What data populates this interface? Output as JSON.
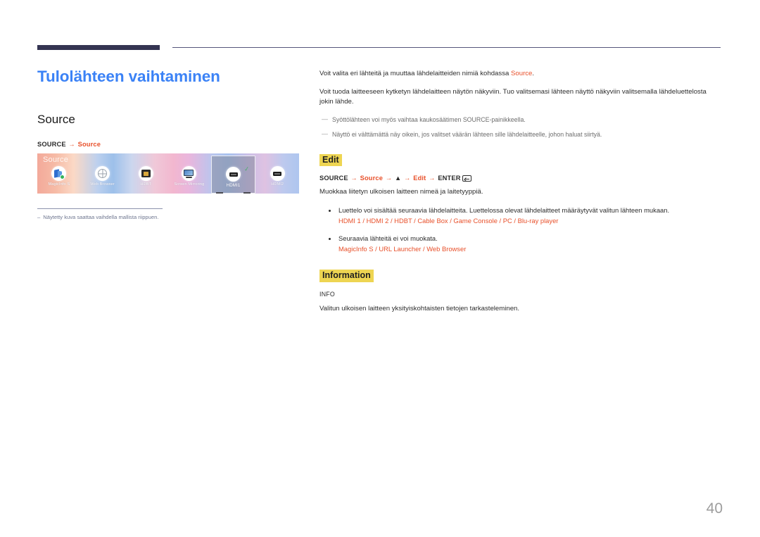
{
  "document": {
    "title": "Tulolähteen vaihtaminen",
    "page_number": "40",
    "accent_color": "#e8502a",
    "title_color": "#3b82f6",
    "highlight_color": "#eed552",
    "rule_color": "#343452"
  },
  "left": {
    "section_heading": "Source",
    "path": {
      "root": "SOURCE",
      "arrow": "→",
      "target": "Source"
    },
    "screenshot": {
      "overlay_label": "Source",
      "items": [
        {
          "label": "MagicInfo S",
          "icon": "magicinfo-icon",
          "selected": false
        },
        {
          "label": "Web Browser",
          "icon": "globe-icon",
          "selected": false
        },
        {
          "label": "HDBT",
          "icon": "hdbt-connector-icon",
          "selected": false
        },
        {
          "label": "Screen Mirroring",
          "icon": "screen-mirroring-icon",
          "selected": false
        },
        {
          "label": "HDMI1",
          "icon": "hdmi-port-icon",
          "selected": true
        },
        {
          "label": "HDMI2",
          "icon": "hdmi-port-icon",
          "selected": false
        }
      ],
      "caret_glyph": "⌃",
      "check_glyph": "✓"
    },
    "caption": {
      "dash": "‒",
      "text": "Näytetty kuva saattaa vaihdella mallista riippuen."
    }
  },
  "right": {
    "intro_paragraphs": [
      {
        "before": "Voit valita eri lähteitä ja muuttaa lähdelaitteiden nimiä kohdassa ",
        "accent": "Source",
        "after": "."
      },
      {
        "before": "Voit tuoda laitteeseen kytketyn lähdelaitteen näytön näkyviin. Tuo valitsemasi lähteen näyttö näkyviin valitsemalla lähdeluettelosta jokin lähde.",
        "accent": "",
        "after": ""
      }
    ],
    "notes": [
      {
        "dash": "―",
        "text": "Syöttölähteen voi myös vaihtaa kaukosäätimen SOURCE-painikkeella."
      },
      {
        "dash": "―",
        "text": "Näyttö ei välttämättä näy oikein, jos valitset väärän lähteen sille lähdelaitteelle, johon haluat siirtyä."
      }
    ],
    "sections": [
      {
        "heading": "Edit",
        "path": {
          "root": "SOURCE",
          "steps": [
            "Source",
            "▲",
            "Edit",
            "ENTER"
          ],
          "arrow": "→",
          "enter_icon": "enter-key-icon"
        },
        "description": "Muokkaa liitetyn ulkoisen laitteen nimeä ja laitetyyppiä.",
        "bullets": [
          {
            "text": "Luettelo voi sisältää seuraavia lähdelaitteita. Luettelossa olevat lähdelaitteet määräytyvät valitun lähteen mukaan.",
            "options": "HDMI 1 / HDMI 2 / HDBT / Cable Box / Game Console / PC / Blu-ray player"
          },
          {
            "text": "Seuraavia lähteitä ei voi muokata.",
            "options": "MagicInfo S / URL Launcher / Web Browser"
          }
        ]
      },
      {
        "heading": "Information",
        "sub_label": "INFO",
        "description": "Valitun ulkoisen laitteen yksityiskohtaisten tietojen tarkasteleminen."
      }
    ]
  }
}
